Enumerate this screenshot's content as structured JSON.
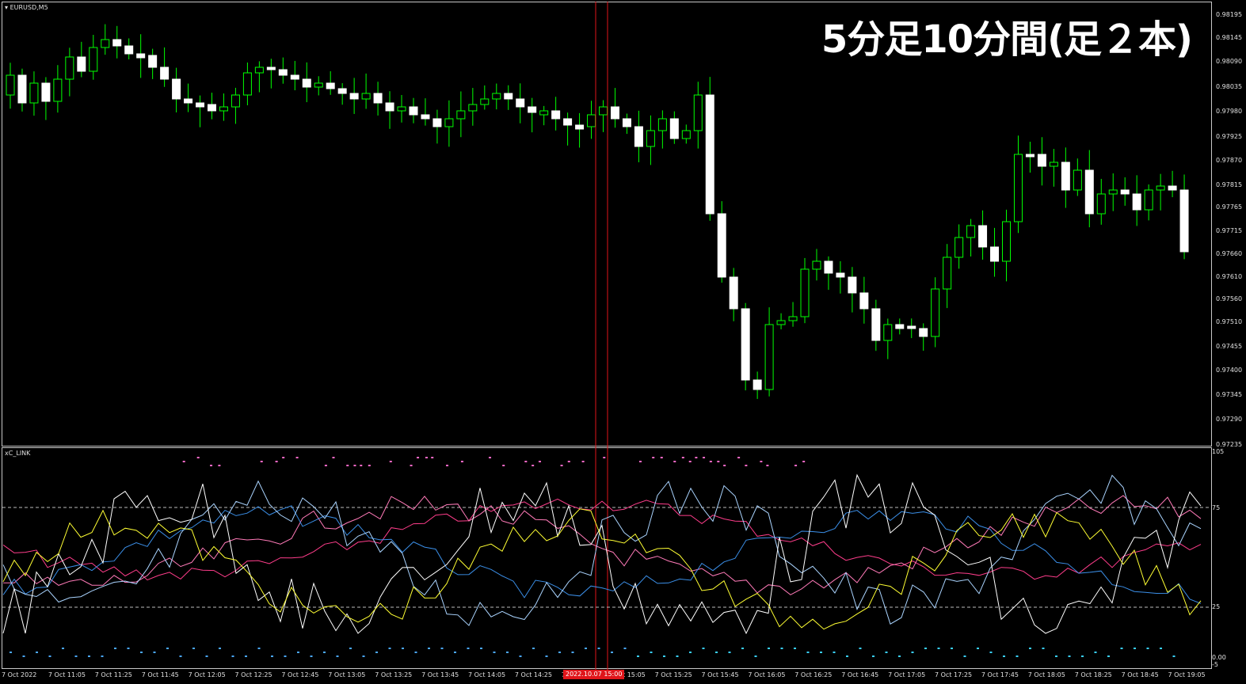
{
  "main_pane": {
    "symbol_label": "EURUSD,M5",
    "overlay_title": "5分足10分間(足２本)",
    "price_axis": [
      "0.98195",
      "0.98145",
      "0.98090",
      "0.98035",
      "0.97980",
      "0.97925",
      "0.97870",
      "0.97815",
      "0.97765",
      "0.97715",
      "0.97660",
      "0.97610",
      "0.97560",
      "0.97510",
      "0.97455",
      "0.97400",
      "0.97345",
      "0.97290",
      "0.97235"
    ]
  },
  "sub_pane": {
    "indicator_label": "xC_LINK",
    "levels_axis": [
      "105",
      "75",
      "25",
      "0.00",
      "-5"
    ]
  },
  "time_axis": [
    "7 Oct 2022",
    "7 Oct 11:05",
    "7 Oct 11:25",
    "7 Oct 11:45",
    "7 Oct 12:05",
    "7 Oct 12:25",
    "7 Oct 12:45",
    "7 Oct 13:05",
    "7 Oct 13:25",
    "7 Oct 13:45",
    "7 Oct 14:05",
    "7 Oct 14:25",
    "7 Oct 14:45",
    "7 Oct 15:05",
    "7 Oct 15:25",
    "7 Oct 15:45",
    "7 Oct 16:05",
    "7 Oct 16:25",
    "7 Oct 16:45",
    "7 Oct 17:05",
    "7 Oct 17:25",
    "7 Oct 17:45",
    "7 Oct 18:05",
    "7 Oct 18:25",
    "7 Oct 18:45",
    "7 Oct 19:05"
  ],
  "cursor_tag": "2022.10.07 15:00",
  "colors": {
    "background": "#000000",
    "bull_body": "#000000",
    "bear_body": "#ffffff",
    "wick": "#00ff00",
    "vline": "#e0151a",
    "lines": [
      "#ff3d8b",
      "#ff7ab8",
      "#3b8fe8",
      "#aad4ff",
      "#ffffff",
      "#ffff33"
    ]
  }
}
